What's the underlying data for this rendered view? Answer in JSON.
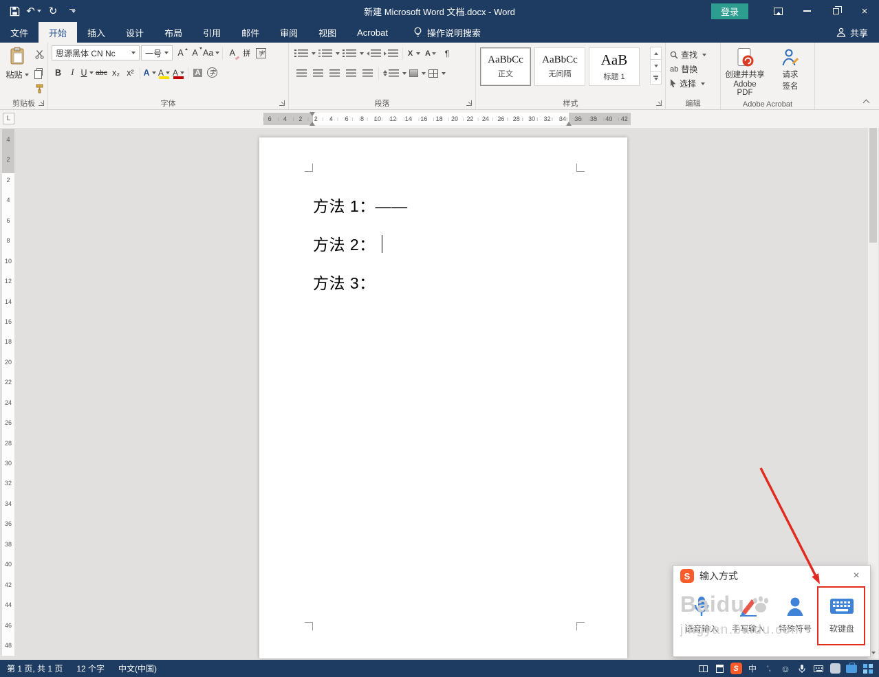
{
  "colors": {
    "navy": "#1e3c61",
    "tab-blue": "#2b579a",
    "login-green": "#2d9d8f",
    "ribbon-bg": "#f3f2f1",
    "doc-bg": "#e2e0df",
    "red": "#e02b20",
    "sogou-orange": "#fb5b2a",
    "icon-blue": "#3f83d8",
    "font-red": "#c00000",
    "highlight-yellow": "#ffdd00"
  },
  "titlebar": {
    "title": "新建 Microsoft Word 文档.docx - Word",
    "login": "登录"
  },
  "tabs": [
    {
      "label": "文件"
    },
    {
      "label": "开始"
    },
    {
      "label": "插入"
    },
    {
      "label": "设计"
    },
    {
      "label": "布局"
    },
    {
      "label": "引用"
    },
    {
      "label": "邮件"
    },
    {
      "label": "审阅"
    },
    {
      "label": "视图"
    },
    {
      "label": "Acrobat"
    }
  ],
  "tellme": "操作说明搜索",
  "share": "共享",
  "ribbon": {
    "clipboard": {
      "paste": "粘贴",
      "group": "剪贴板"
    },
    "font": {
      "name": "思源黑体 CN Nc",
      "size": "一号",
      "group": "字体"
    },
    "paragraph": {
      "group": "段落"
    },
    "styles": {
      "group": "样式",
      "items": [
        {
          "preview": "AaBbCc",
          "name": "正文"
        },
        {
          "preview": "AaBbCc",
          "name": "无间隔"
        },
        {
          "preview": "AaB",
          "name": "标题 1"
        }
      ]
    },
    "editing": {
      "find": "查找",
      "replace": "替换",
      "select": "选择",
      "group": "编辑"
    },
    "acrobat": {
      "create_line1": "创建并共享",
      "create_line2": "Adobe PDF",
      "sign_line1": "请求",
      "sign_line2": "签名",
      "group": "Adobe Acrobat"
    }
  },
  "icons": {
    "undo": "↶",
    "redo": "↻",
    "close": "×",
    "bold": "B",
    "italic": "I",
    "underline": "U",
    "strikethrough": "abc",
    "subscript": "x₂",
    "superscript": "x²",
    "grow_font": "A",
    "shrink_font": "A",
    "change_case": "Aa",
    "clear_formatting": "A",
    "phonetic_guide": "拼",
    "enclose_characters": "字",
    "text_effects": "A",
    "highlight": "A",
    "font_color": "A",
    "char_shading": "A",
    "circle_char": "字",
    "chinese_layout": "X",
    "sort": "A",
    "para_mark": "¶",
    "replace_icon": "ab",
    "tab_selector": "L",
    "sogou": "S",
    "ime_mode": "中",
    "punctuation": "’,",
    "smiley": "☺"
  },
  "ruler": {
    "horizontal": [
      "6",
      "4",
      "2",
      "2",
      "4",
      "6",
      "8",
      "10",
      "12",
      "14",
      "16",
      "18",
      "20",
      "22",
      "24",
      "26",
      "28",
      "30",
      "32",
      "34",
      "36",
      "38",
      "40",
      "42"
    ],
    "vertical": [
      "4",
      "2",
      "2",
      "4",
      "6",
      "8",
      "10",
      "12",
      "14",
      "16",
      "18",
      "20",
      "22",
      "24",
      "26",
      "28",
      "30",
      "32",
      "34",
      "36",
      "38",
      "40",
      "42",
      "44",
      "46",
      "48"
    ]
  },
  "document": {
    "lines": [
      {
        "text": "方法 1：——"
      },
      {
        "text": "方法 2："
      },
      {
        "text": "方法 3："
      }
    ]
  },
  "popup": {
    "title": "输入方式",
    "items": [
      {
        "label": "语音输入"
      },
      {
        "label": "手写输入"
      },
      {
        "label": "特殊符号"
      },
      {
        "label": "软键盘"
      }
    ]
  },
  "watermark": {
    "title": "Baidu",
    "subtitle": "jingyan.baidu.com"
  },
  "statusbar": {
    "page_info": "第 1 页, 共 1 页",
    "word_count": "12 个字",
    "language": "中文(中国)"
  }
}
